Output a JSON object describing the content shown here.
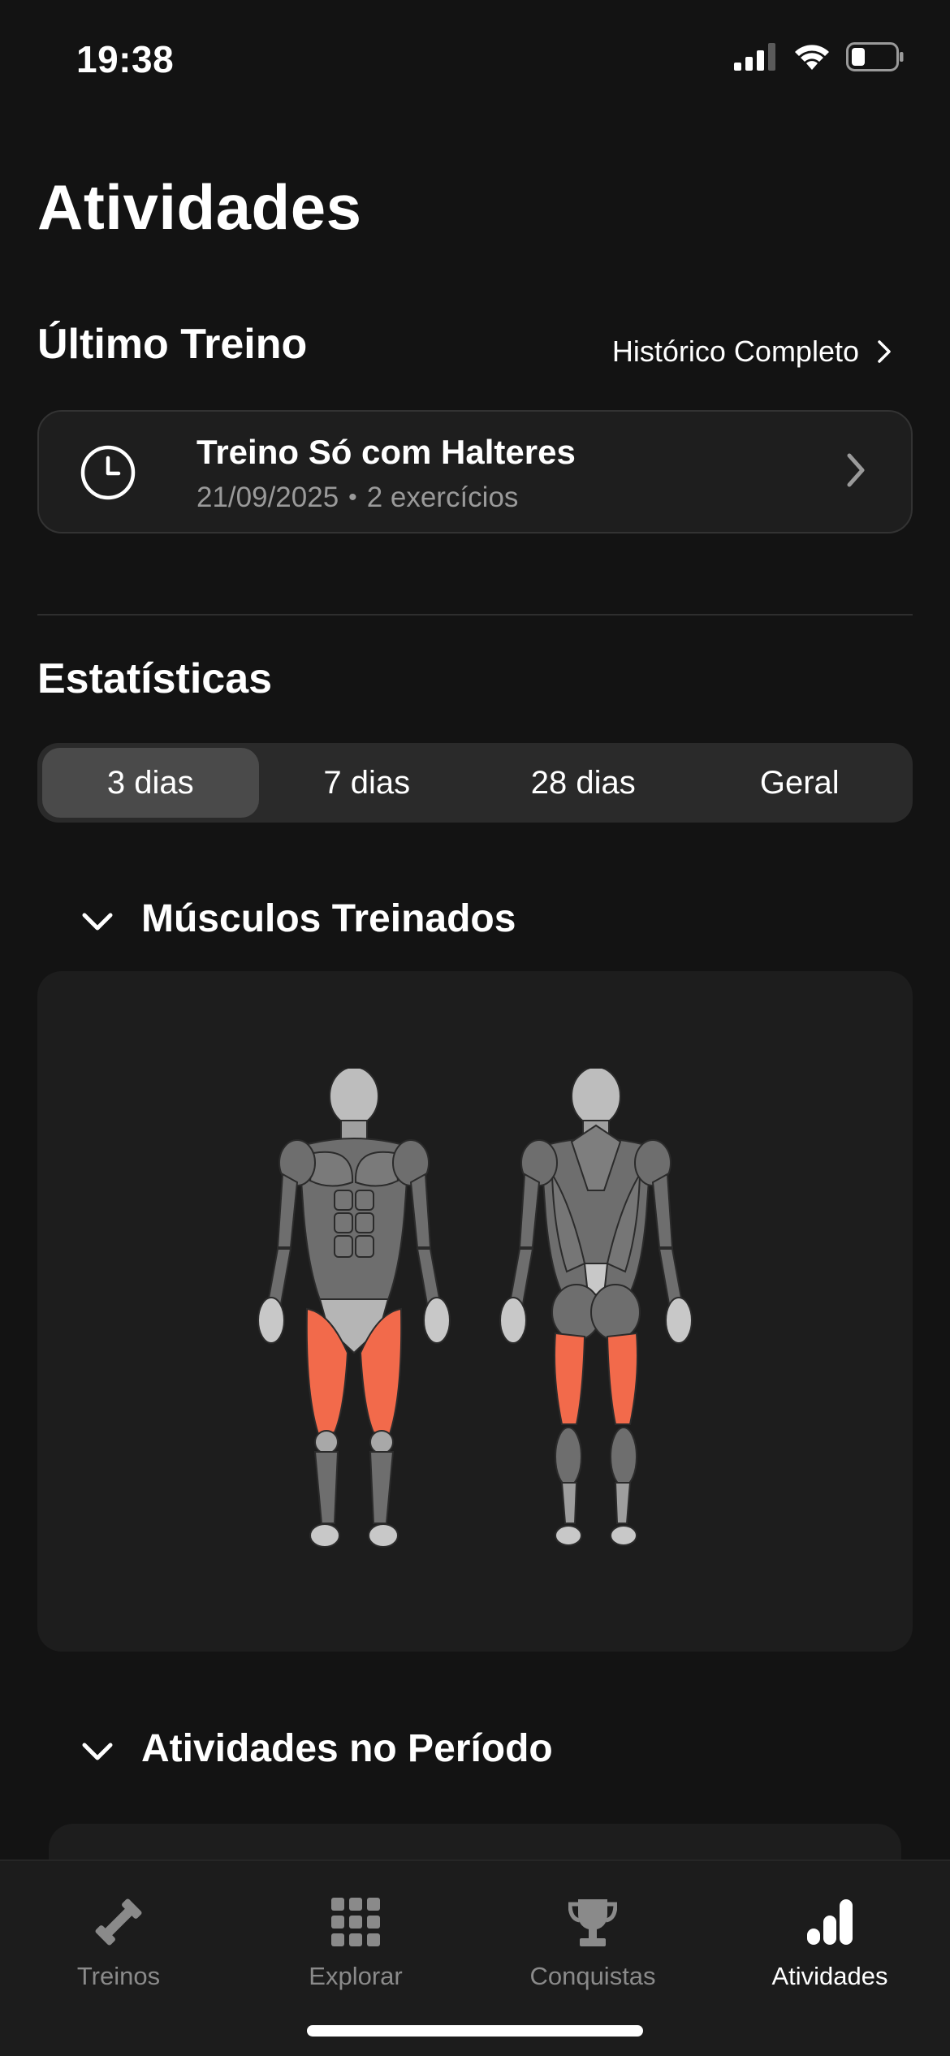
{
  "status_bar": {
    "time": "19:38"
  },
  "page": {
    "title": "Atividades"
  },
  "last_workout": {
    "section_title": "Último Treino",
    "history_link": "Histórico Completo",
    "card": {
      "title": "Treino Só com Halteres",
      "date": "21/09/2025",
      "separator": "•",
      "exercises": "2 exercícios"
    }
  },
  "statistics": {
    "section_title": "Estatísticas",
    "segments": [
      {
        "label": "3 dias",
        "selected": true
      },
      {
        "label": "7 dias",
        "selected": false
      },
      {
        "label": "28 dias",
        "selected": false
      },
      {
        "label": "Geral",
        "selected": false
      }
    ]
  },
  "muscles": {
    "title": "Músculos Treinados",
    "highlighted": [
      "quadriceps",
      "hamstrings"
    ],
    "highlight_color": "#f26a4b"
  },
  "period": {
    "title": "Atividades no Período"
  },
  "tab_bar": {
    "items": [
      {
        "label": "Treinos",
        "icon": "dumbbell-icon",
        "active": false
      },
      {
        "label": "Explorar",
        "icon": "grid-icon",
        "active": false
      },
      {
        "label": "Conquistas",
        "icon": "trophy-icon",
        "active": false
      },
      {
        "label": "Atividades",
        "icon": "bar-chart-icon",
        "active": true
      }
    ]
  },
  "colors": {
    "background": "#131313",
    "card": "#1e1e1e",
    "accent_muscle": "#f26a4b",
    "inactive_tab": "#8a8a8a"
  }
}
